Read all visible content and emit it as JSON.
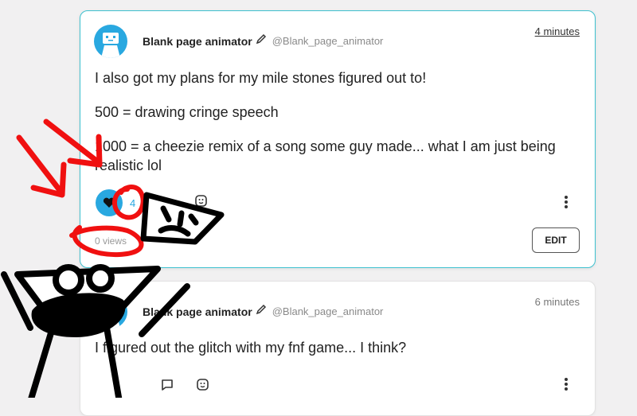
{
  "post1": {
    "author_name": "Blank page animator",
    "author_handle": "@Blank_page_animator",
    "time": "4 minutes",
    "paragraphs": [
      "I also got my plans for my mile stones figured out to!",
      "500 = drawing cringe speech",
      "1000 = a cheezie remix of a song some guy made... what I am just being realistic lol"
    ],
    "likes": "4",
    "views": "0 views",
    "edit_label": "EDIT"
  },
  "post2": {
    "author_name": "Blank page animator",
    "author_handle": "@Blank_page_animator",
    "time": "6 minutes",
    "body": "I figured out the glitch with my fnf game... I think?"
  },
  "colors": {
    "accent": "#29a8e0",
    "card_border_active": "#3ec1cf",
    "doodle_red": "#f01010",
    "doodle_black": "#000000"
  },
  "icons": [
    "avatar-robot-icon",
    "pencil-icon",
    "heart-icon",
    "emoji-add-icon",
    "more-vertical-icon",
    "comment-icon"
  ]
}
